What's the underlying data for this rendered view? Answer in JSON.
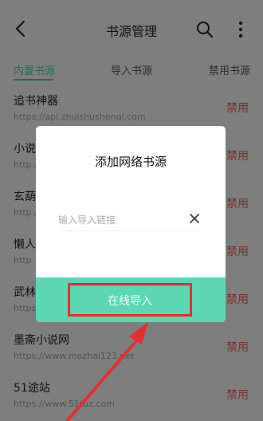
{
  "header": {
    "title": "书源管理",
    "back_icon": "back-arrow-icon",
    "search_icon": "search-icon",
    "more_icon": "more-vertical-icon"
  },
  "tabs": [
    {
      "label": "内置书源",
      "active": true
    },
    {
      "label": "导入书源",
      "active": false
    },
    {
      "label": "禁用书源",
      "active": false
    }
  ],
  "sources": [
    {
      "name": "追书神器",
      "url": "https://api.zhuishushenqi.com",
      "action": "禁用"
    },
    {
      "name": "小说",
      "url": "http://",
      "action": "禁用"
    },
    {
      "name": "玄葫",
      "url": "http://",
      "action": "禁用"
    },
    {
      "name": "懒人",
      "url": "http",
      "action": "禁用"
    },
    {
      "name": "武林",
      "url": "https",
      "action": "禁用"
    },
    {
      "name": "墨斋小说网",
      "url": "https://www.mozhai123.net",
      "action": "禁用"
    },
    {
      "name": "51途站",
      "url": "https://www.51tuz.com",
      "action": "禁用"
    }
  ],
  "dialog": {
    "title": "添加网络书源",
    "input_placeholder": "输入导入链接",
    "input_value": "",
    "clear_icon": "close-icon",
    "import_label": "在线导入"
  },
  "colors": {
    "accent": "#44c9a6",
    "dialog_bar": "#5cd7b4",
    "disable_text": "#e8584f",
    "highlight": "#e12f2f"
  }
}
